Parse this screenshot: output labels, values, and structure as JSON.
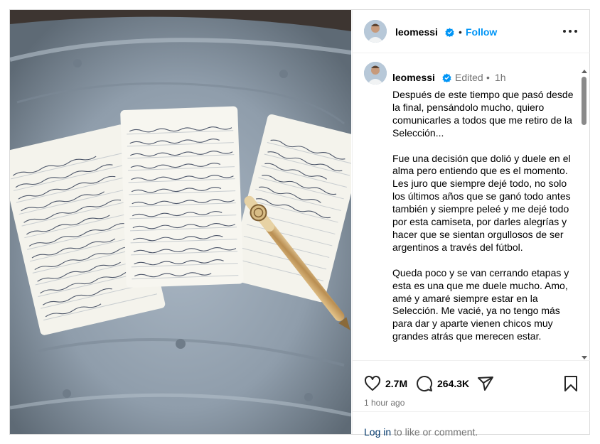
{
  "post": {
    "username": "leomessi",
    "follow_label": "Follow",
    "separator": "•",
    "edited_label": "Edited",
    "time_short": "1h",
    "caption": "Después de este tiempo que pasó desde la final, pensándolo mucho, quiero comunicarles a todos que me retiro de la Selección...\n\nFue una decisión que dolió y duele en el alma pero entiendo que es el momento. Les juro que siempre dejé todo, no solo los últimos años que se ganó todo antes también y siempre peleé y me dejé todo por esta camiseta, por darles alegrías y hacer que se sientan orgullosos de ser argentinos a través del fútbol.\n\nQueda poco y se van cerrando etapas y esta es una que me duele mucho. Amo, amé y amaré siempre estar en la Selección. Me vacié, ya no tengo más para dar y aparte vienen chicos muy grandes atrás que merecen estar.",
    "likes": "2.7M",
    "comments": "264.3K",
    "time_ago": "1 hour ago",
    "login_link": "Log in",
    "login_suffix": " to like or comment."
  },
  "colors": {
    "accent": "#0095f6",
    "verified": "#0095f6",
    "link_dark": "#00376b",
    "muted": "#737373"
  },
  "icons": [
    "verified-badge-icon",
    "more-options-icon",
    "heart-icon",
    "comment-icon",
    "share-icon",
    "bookmark-icon"
  ]
}
